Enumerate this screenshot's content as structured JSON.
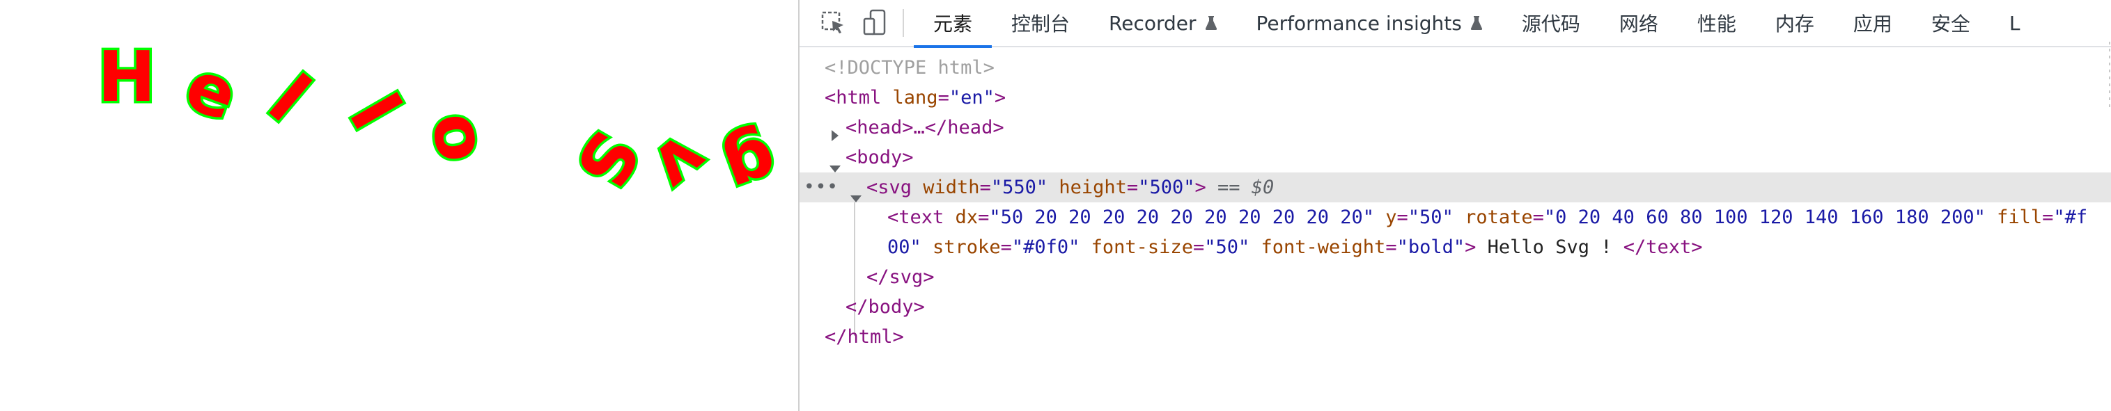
{
  "page": {
    "svg_text": "Hello Svg !",
    "svg_fill": "#ff0000",
    "svg_stroke": "#00ff00",
    "rotations": [
      0,
      20,
      40,
      60,
      80,
      100,
      120,
      140,
      160,
      180,
      200
    ]
  },
  "toolbar": {
    "inspect_icon": "inspect-element-icon",
    "device_icon": "device-toggle-icon",
    "tabs": [
      {
        "label": "元素",
        "active": true
      },
      {
        "label": "控制台"
      },
      {
        "label": "Recorder",
        "flask": true
      },
      {
        "label": "Performance insights",
        "flask": true
      },
      {
        "label": "源代码"
      },
      {
        "label": "网络"
      },
      {
        "label": "性能"
      },
      {
        "label": "内存"
      },
      {
        "label": "应用"
      },
      {
        "label": "安全"
      },
      {
        "label": "L"
      }
    ]
  },
  "tree": {
    "doctype": "<!DOCTYPE html>",
    "html_open_tag": "<html",
    "html_lang_attr": " lang",
    "html_lang_val": "\"en\"",
    "html_close_bracket": ">",
    "head_collapsed": "<head>…</head>",
    "body_open": "<body>",
    "svg_open": "<svg",
    "svg_width_attr": " width",
    "svg_width_val": "\"550\"",
    "svg_height_attr": " height",
    "svg_height_val": "\"500\"",
    "svg_gt": ">",
    "svg_eq": " == $0",
    "text_open": "<text",
    "dx_attr": " dx",
    "dx_val": "\"50 20 20 20 20 20 20 20 20 20 20\"",
    "y_attr": " y",
    "y_val": "\"50\"",
    "rotate_attr": " rotate",
    "rotate_val": "\"0 20 40 60 80 100 120 140 160 180 200\"",
    "fill_attr": " fill",
    "fill_val_part1": "\"#f",
    "fill_val_part2": "00\"",
    "stroke_attr": " stroke",
    "stroke_val": "\"#0f0\"",
    "fontsize_attr": " font-size",
    "fontsize_val": "\"50\"",
    "fontweight_attr": " font-weight",
    "fontweight_val": "\"bold\"",
    "text_gt": ">",
    "text_content": " Hello Svg ! ",
    "text_close": "</text>",
    "svg_close": "</svg>",
    "body_close": "</body>",
    "html_close": "</html>",
    "ellipsis": "•••"
  },
  "colors": {
    "tab_active_underline": "#1a73e8",
    "tag": "#881280",
    "attr": "#994500",
    "val": "#1a1aa6"
  }
}
